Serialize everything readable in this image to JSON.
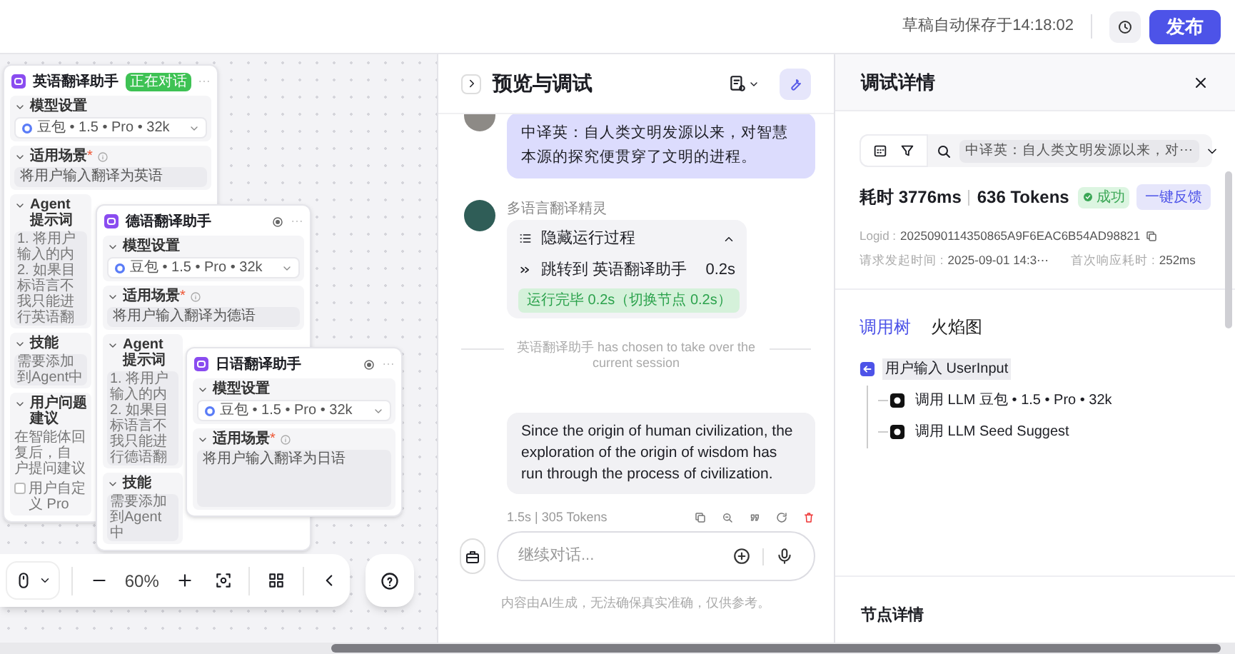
{
  "top_bar": {
    "autosave": "草稿自动保存于14:18:02",
    "publish": "发布"
  },
  "canvas": {
    "cards": [
      {
        "title": "英语翻译助手",
        "badge": "正在对话",
        "sections": [
          {
            "kind": "model",
            "label": "模型设置",
            "value": "豆包 • 1.5 • Pro • 32k"
          },
          {
            "kind": "field",
            "label": "适用场景",
            "mark": "*",
            "text": "将用户输入翻译为英语"
          },
          {
            "kind": "lines",
            "label": "Agent 提示词",
            "lines": [
              "1. 将用户输入的内",
              "2. 如果目标语言不",
              "我只能进行英语翻"
            ]
          },
          {
            "kind": "lines",
            "label": "技能",
            "lines": [
              "需要添加到Agent中"
            ]
          },
          {
            "kind": "lines",
            "label": "用户问题建议",
            "lines": [
              "在智能体回复后，自",
              "户提问建议"
            ],
            "checkbox": {
              "label": "用户自定义 Pro",
              "checked": false
            }
          }
        ]
      },
      {
        "title": "德语翻译助手",
        "sections": [
          {
            "kind": "model",
            "label": "模型设置",
            "value": "豆包 • 1.5 • Pro • 32k"
          },
          {
            "kind": "field",
            "label": "适用场景",
            "mark": "*",
            "text": "将用户输入翻译为德语"
          },
          {
            "kind": "lines",
            "label": "Agent 提示词",
            "lines": [
              "1. 将用户输入的内",
              "2. 如果目标语言不",
              "我只能进行德语翻"
            ]
          },
          {
            "kind": "lines",
            "label": "技能",
            "lines": [
              "需要添加到Agent中"
            ]
          }
        ]
      },
      {
        "title": "日语翻译助手",
        "sections": [
          {
            "kind": "model",
            "label": "模型设置",
            "value": "豆包 • 1.5 • Pro • 32k"
          },
          {
            "kind": "field",
            "label": "适用场景",
            "mark": "*",
            "text": "将用户输入翻译为日语"
          }
        ]
      }
    ],
    "zoom": "60%"
  },
  "preview": {
    "title": "预览与调试",
    "user_message": "中译英：自人类文明发源以来，对智慧本源的探究便贯穿了文明的进程。",
    "bot_name": "多语言翻译精灵",
    "process": {
      "toggle": "隐藏运行过程",
      "expanded": true,
      "step": "跳转到 英语翻译助手",
      "step_time": "0.2s",
      "status": "运行完毕 0.2s（切换节点 0.2s）"
    },
    "handoff_notice": "英语翻译助手 has chosen to take over the current session",
    "answer": "Since the origin of human civilization, the exploration of the origin of wisdom has run through the process of civilization.",
    "answer_meta": "1.5s | 305 Tokens",
    "input": {
      "placeholder": "继续对话..."
    },
    "disclaimer": "内容由AI生成，无法确保真实准确，仅供参考。"
  },
  "debug": {
    "title": "调试详情",
    "search_value": "中译英：自人类文明发源以来，对⋯",
    "duration": "耗时 3776ms",
    "tokens": "636 Tokens",
    "status": "成功",
    "feedback": "一键反馈",
    "logid_label": "Logid :",
    "logid": "2025090114350865A9F6EAC6B54AD98821",
    "request_label": "请求发起时间 :",
    "request_time": "2025-09-01 14:3⋯",
    "first_label": "首次响应耗时 :",
    "first_time": "252ms",
    "tabs": [
      {
        "label": "调用树",
        "selected": true
      },
      {
        "label": "火焰图",
        "selected": false
      }
    ],
    "tree": [
      {
        "label": "用户输入 UserInput",
        "kind": "input",
        "selected": true,
        "children": [
          {
            "label": "调用 LLM 豆包 • 1.5 • Pro • 32k",
            "kind": "llm",
            "selected": false
          },
          {
            "label": "调用 LLM Seed Suggest",
            "kind": "llm",
            "selected": false
          }
        ]
      }
    ],
    "node_details": "节点详情"
  }
}
